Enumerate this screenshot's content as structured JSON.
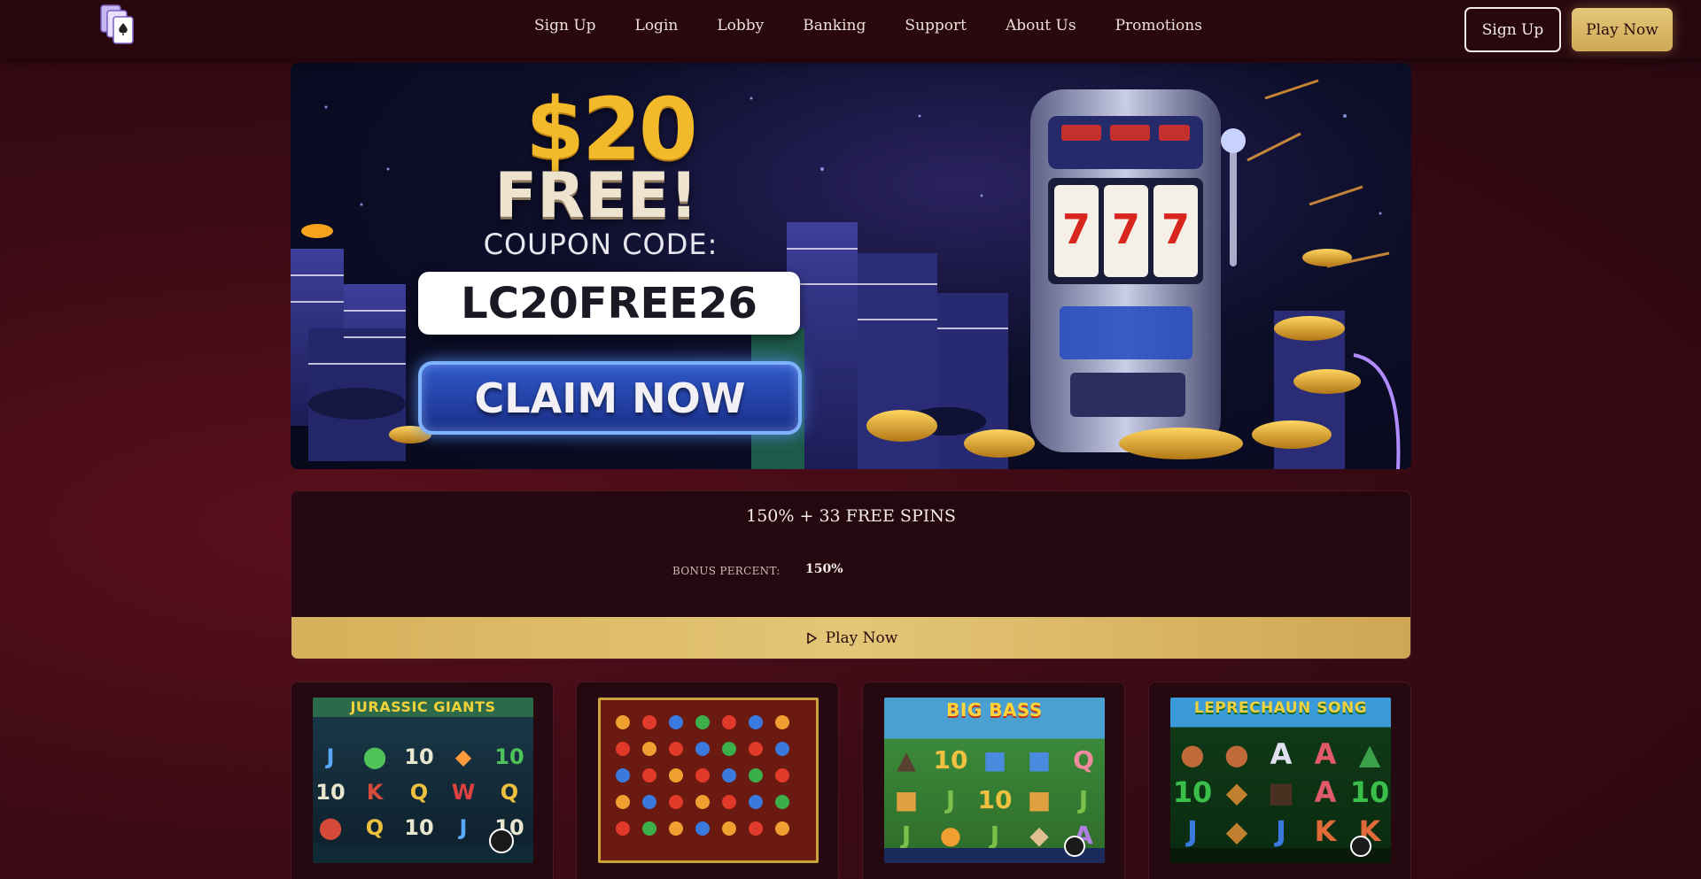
{
  "header": {
    "logo_icon": "playing-cards-logo",
    "nav": [
      "Sign Up",
      "Login",
      "Lobby",
      "Banking",
      "Support",
      "About Us",
      "Promotions"
    ],
    "signup_label": "Sign Up",
    "playnow_label": "Play Now"
  },
  "hero": {
    "amount": "$20",
    "free": "FREE!",
    "coupon_label": "COUPON CODE:",
    "coupon_code": "LC20FREE26",
    "claim_label": "CLAIM NOW",
    "slot_symbols": [
      "7",
      "7",
      "7"
    ]
  },
  "bonus": {
    "title": "150% + 33 FREE SPINS",
    "percent_label": "BONUS PERCENT:",
    "percent_value": "150%",
    "play_label": "Play Now",
    "play_icon": "play-circle-icon"
  },
  "games": [
    {
      "title": "JURASSIC GIANTS",
      "theme": "#1b5a66"
    },
    {
      "title": "",
      "theme": "#6a1a10"
    },
    {
      "title": "BIG BASS",
      "theme": "#2f6a2a"
    },
    {
      "title": "LEPRECHAUN SONG",
      "theme": "#0f4a1a"
    }
  ],
  "colors": {
    "background": "#3a0a14",
    "header": "#28070f",
    "gold": "#dcbb68",
    "claim_blue": "#2f58c7"
  }
}
